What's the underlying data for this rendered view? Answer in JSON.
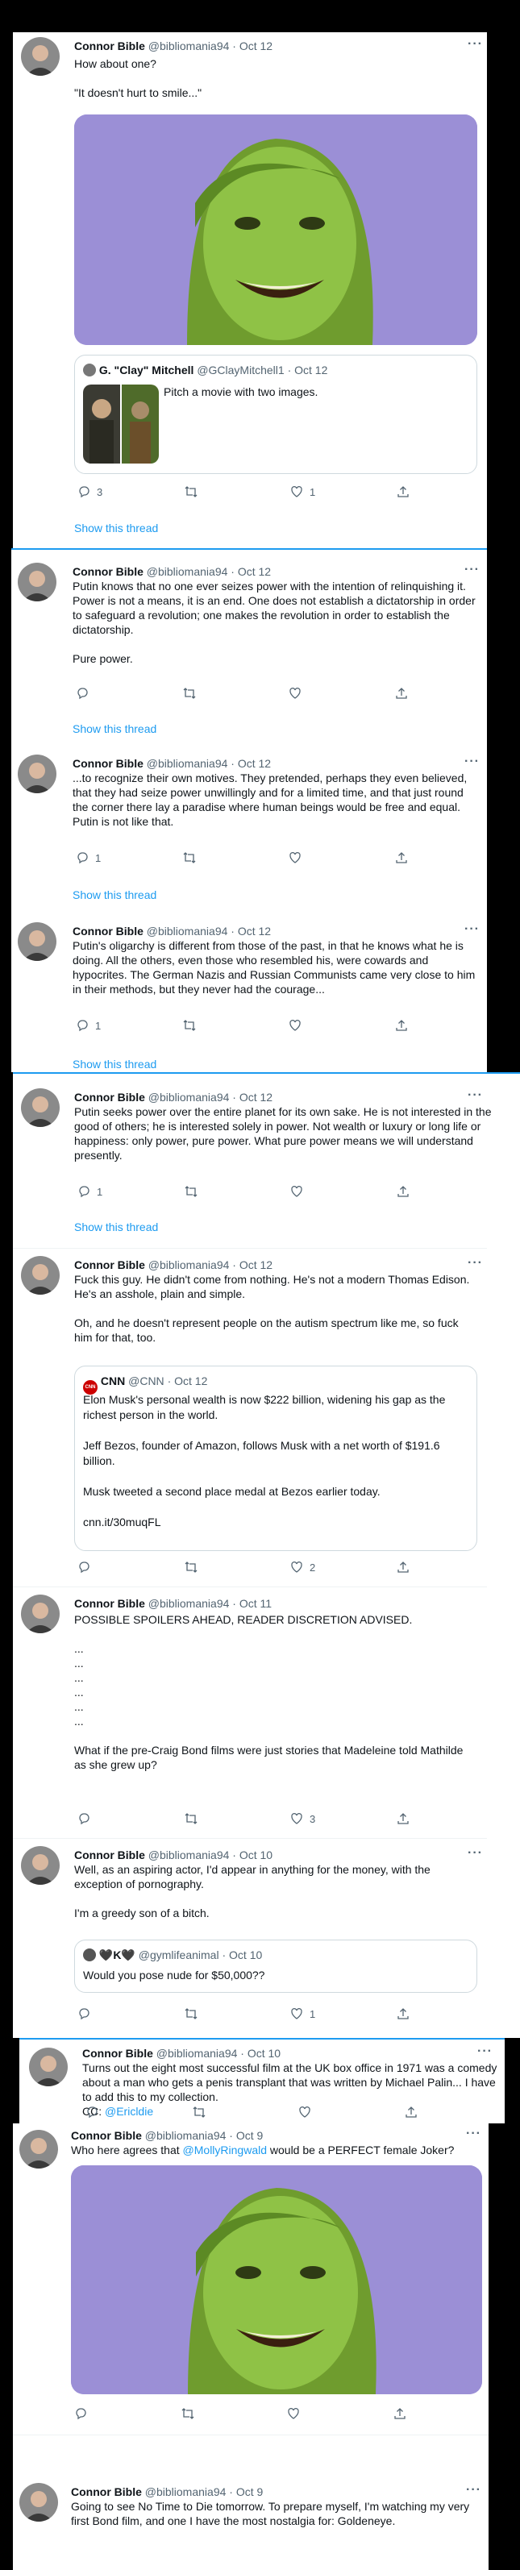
{
  "tweets": [
    {
      "name": "Connor Bible",
      "handle": "@bibliomania94",
      "date": "· Oct 12",
      "text": "How about one?\n\n\"It doesn't hurt to smile...\"",
      "reply": "3",
      "retweet": "",
      "like": "1",
      "show_thread": "Show this thread"
    },
    {
      "name": "Connor Bible",
      "handle": "@bibliomania94",
      "date": "· Oct 12",
      "text": "Putin knows that no one ever seizes power with the intention of relinquishing it. Power is not a means, it is an end. One does not establish a dictatorship in order to safeguard a revolution; one makes the revolution in order to establish the dictatorship.\n\nPure power.",
      "reply": "",
      "retweet": "",
      "like": "",
      "show_thread": "Show this thread"
    },
    {
      "name": "Connor Bible",
      "handle": "@bibliomania94",
      "date": "· Oct 12",
      "text": "...to recognize their own motives. They pretended, perhaps they even believed, that they had seize power unwillingly and for a limited time, and that just round the corner there lay a paradise where human beings would be free and equal. Putin is not like that.",
      "reply": "1",
      "retweet": "",
      "like": "",
      "show_thread": "Show this thread"
    },
    {
      "name": "Connor Bible",
      "handle": "@bibliomania94",
      "date": "· Oct 12",
      "text": "Putin's oligarchy is different from those of the past, in that he knows what he is doing. All the others, even those who resembled his, were cowards and hypocrites. The German Nazis and Russian Communists came very close to him in their methods, but they never had the courage...",
      "reply": "1",
      "retweet": "",
      "like": "",
      "show_thread": "Show this thread"
    },
    {
      "name": "Connor Bible",
      "handle": "@bibliomania94",
      "date": "· Oct 12",
      "text": "Putin seeks power over the entire planet for its own sake. He is not interested in the good of others; he is interested solely in power. Not wealth or luxury or long life or happiness: only power, pure power. What pure power means we will understand presently.",
      "reply": "1",
      "retweet": "",
      "like": "",
      "show_thread": "Show this thread"
    },
    {
      "name": "Connor Bible",
      "handle": "@bibliomania94",
      "date": "· Oct 12",
      "text": "Fuck this guy. He didn't come from nothing. He's not a modern Thomas Edison. He's an asshole, plain and simple.\n\nOh, and he doesn't represent people on the autism spectrum like me, so fuck him for that, too.",
      "reply": "",
      "retweet": "",
      "like": "2"
    },
    {
      "name": "Connor Bible",
      "handle": "@bibliomania94",
      "date": "· Oct 11",
      "text": "POSSIBLE SPOILERS AHEAD, READER DISCRETION ADVISED.\n\n...\n...\n...\n...\n...\n...\n\nWhat if the pre-Craig Bond films were just stories that Madeleine told Mathilde as she grew up?",
      "reply": "",
      "retweet": "",
      "like": "3"
    },
    {
      "name": "Connor Bible",
      "handle": "@bibliomania94",
      "date": "· Oct 10",
      "text": "Well, as an aspiring actor, I'd appear in anything for the money, with the exception of pornography.\n\nI'm a greedy son of a bitch.",
      "reply": "",
      "retweet": "",
      "like": "1"
    },
    {
      "name": "Connor Bible",
      "handle": "@bibliomania94",
      "date": "· Oct 10",
      "text": "Turns out the eight most successful film at the UK box office in 1971 was a comedy about a man who gets a penis transplant that was written by Michael Palin... I have to add this to my collection.\nCC: ",
      "mention": "@Ericldie",
      "reply": "",
      "retweet": "",
      "like": ""
    },
    {
      "name": "Connor Bible",
      "handle": "@bibliomania94",
      "date": "· Oct 9",
      "text_pre": "Who here agrees that ",
      "mention": "@MollyRingwald",
      "text_post": " would be a PERFECT female Joker?",
      "reply": "",
      "retweet": "",
      "like": ""
    },
    {
      "name": "Connor Bible",
      "handle": "@bibliomania94",
      "date": "· Oct 9",
      "text": "Going to see No Time to Die tomorrow. To prepare myself, I'm watching my very first Bond film, and one I have the most nostalgia for: Goldeneye."
    }
  ],
  "quotes": {
    "clay": {
      "name": "G. \"Clay\" Mitchell",
      "handle": "@GClayMitchell1",
      "date": "· Oct 12",
      "text": "Pitch a movie with two images."
    },
    "cnn": {
      "name": "CNN",
      "handle": "@CNN",
      "date": "· Oct 12",
      "logo": "CNN",
      "text": "Elon Musk's personal wealth is now $222 billion, widening his gap as the richest person in the world.\n\nJeff Bezos, founder of Amazon, follows Musk with a net worth of $191.6 billion.\n\nMusk tweeted a second place medal at Bezos earlier today.\n\ncnn.it/30muqFL"
    },
    "gymlife": {
      "name": "🖤K🖤",
      "handle": "@gymlifeanimal",
      "date": "· Oct 10",
      "text": "Would you pose nude for $50,000??"
    }
  },
  "colors": {
    "accent": "#1d9bf0",
    "secondary_text": "#536471",
    "face_green": "#7fb83a",
    "background_lilac": "#9b8fd6"
  }
}
